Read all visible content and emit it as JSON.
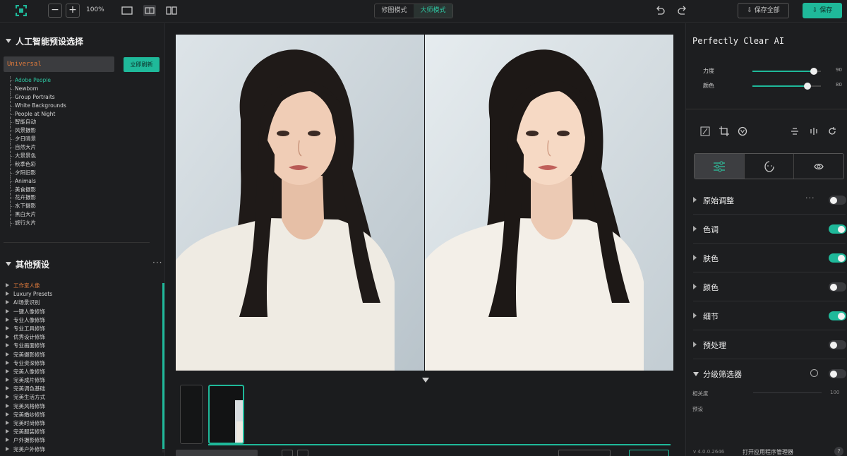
{
  "topbar": {
    "zoom_minus": "−",
    "zoom_plus": "+",
    "zoom_level": "100%",
    "modes": [
      "修图模式",
      "大师模式"
    ],
    "active_mode": 1,
    "save_all": "保存全部",
    "save": "保存"
  },
  "left": {
    "ai_presets_title": "人工智能预设选择",
    "search_value": "Universal",
    "refresh_btn": "立即刷新",
    "ai_presets": [
      "Adobe People",
      "Newborn",
      "Group Portraits",
      "White Backgrounds",
      "People at Night",
      "智能自动",
      "风景摄影",
      "夕日晴景",
      "自然大片",
      "大景景色",
      "秋季色彩",
      "夕阳旧影",
      "Animals",
      "美食摄影",
      "花卉摄影",
      "水下摄影",
      "黑白大片",
      "旅行大片"
    ],
    "ai_presets_selected": 0,
    "other_title": "其他预设",
    "other_presets": [
      "工作室人像",
      "Luxury Presets",
      "AI场景识别",
      "一键人像修饰",
      "专业人像修饰",
      "专业工具修饰",
      "优秀设计修饰",
      "专业画面修饰",
      "完美摄影修饰",
      "专业资深修饰",
      "完美人像修饰",
      "完美成片修饰",
      "完美调色基础",
      "完美生活方式",
      "完美风格修饰",
      "完美婚纱修饰",
      "完美时尚修饰",
      "完美服装修饰",
      "户外摄影修饰",
      "完美户外修饰"
    ],
    "other_selected": 0
  },
  "right": {
    "title": "Perfectly Clear AI",
    "sliders": [
      {
        "label": "力度",
        "value": 90
      },
      {
        "label": "颜色",
        "value": 80
      }
    ],
    "sections": [
      {
        "label": "原始调整",
        "on": false
      },
      {
        "label": "色调",
        "on": true
      },
      {
        "label": "肤色",
        "on": true
      },
      {
        "label": "颜色",
        "on": false
      },
      {
        "label": "细节",
        "on": true
      },
      {
        "label": "预处理",
        "on": false
      }
    ],
    "filter_section": {
      "label": "分级筛选器",
      "on": false,
      "expanded": true
    },
    "sub_rows": [
      {
        "label": "相关度",
        "value": 100
      },
      {
        "label": "预设"
      }
    ],
    "version": "v 4.0.0.2646",
    "open_manager": "打开应用程序管理器",
    "help": "?"
  },
  "colors": {
    "accent": "#1fb99a",
    "warn": "#e07b3c"
  }
}
